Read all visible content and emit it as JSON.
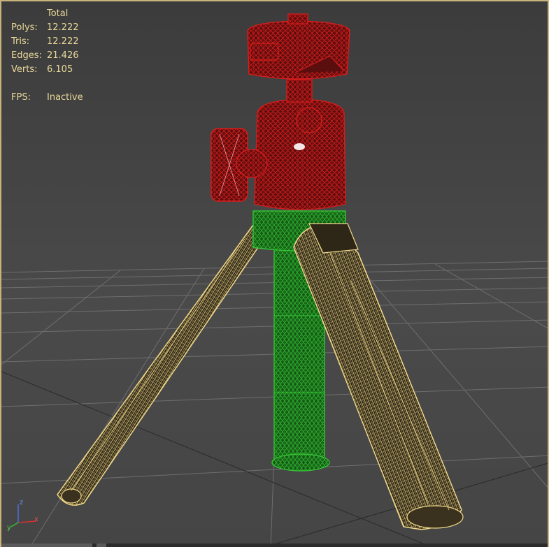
{
  "stats": {
    "header": "Total",
    "rows": [
      {
        "label": "Polys:",
        "value": "12.222"
      },
      {
        "label": "Tris:",
        "value": "12.222"
      },
      {
        "label": "Edges:",
        "value": "21.426"
      },
      {
        "label": "Verts:",
        "value": "6.105"
      }
    ],
    "fps_label": "FPS:",
    "fps_value": "Inactive"
  },
  "axis_gizmo": {
    "x_label": "x",
    "y_label": "y",
    "z_label": "z"
  },
  "colors": {
    "stats_text": "#e9d89a",
    "viewport_border": "#c8b47a",
    "grid_line": "#6e6e6e",
    "head_wireframe": "#c41616",
    "column_wireframe": "#2fb62f",
    "leg_wireframe": "#f2d98a",
    "axis_x": "#d43030",
    "axis_y": "#30c030",
    "axis_z": "#4a70e0"
  }
}
